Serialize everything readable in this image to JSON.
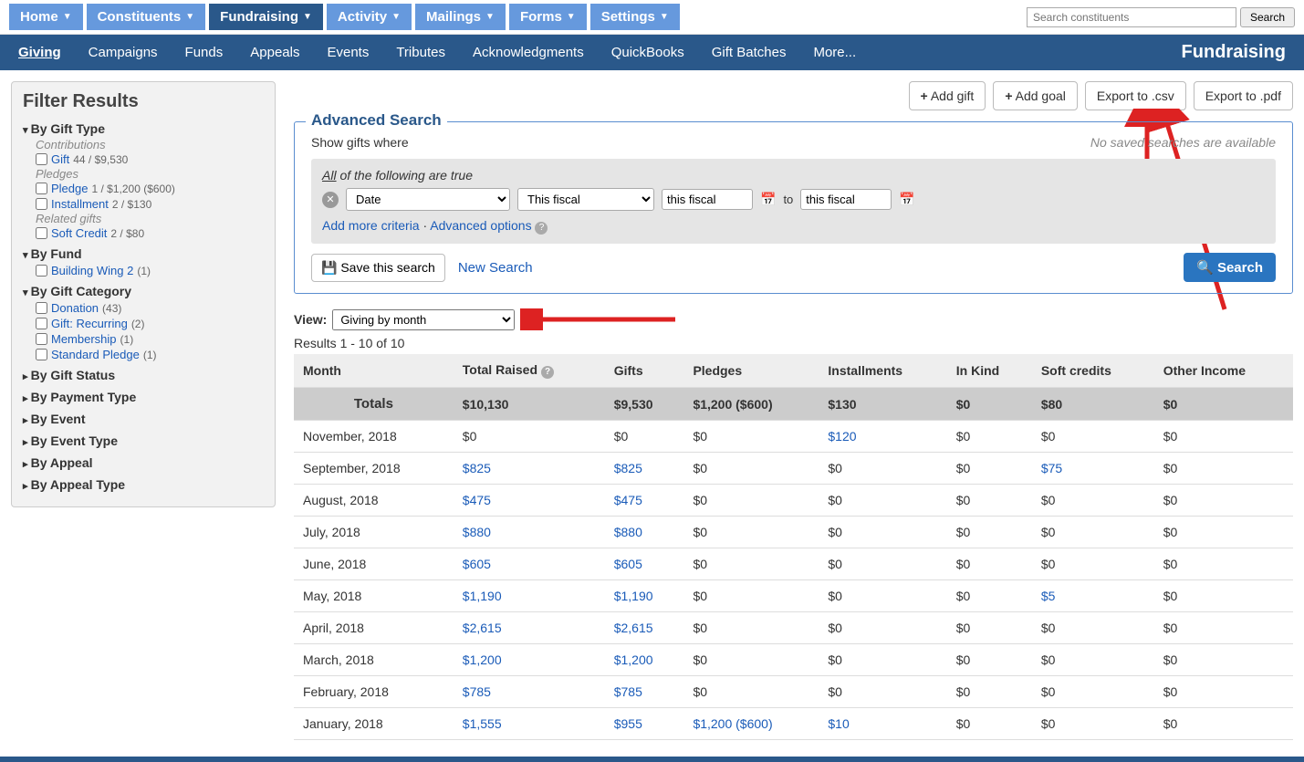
{
  "topnav": [
    {
      "label": "Home"
    },
    {
      "label": "Constituents"
    },
    {
      "label": "Fundraising",
      "active": true
    },
    {
      "label": "Activity"
    },
    {
      "label": "Mailings"
    },
    {
      "label": "Forms"
    },
    {
      "label": "Settings"
    }
  ],
  "search": {
    "placeholder": "Search constituents",
    "button": "Search"
  },
  "subnav": {
    "items": [
      "Giving",
      "Campaigns",
      "Funds",
      "Appeals",
      "Events",
      "Tributes",
      "Acknowledgments",
      "QuickBooks",
      "Gift Batches",
      "More..."
    ],
    "active": "Giving",
    "title": "Fundraising"
  },
  "sidebar": {
    "title": "Filter Results",
    "groups": [
      {
        "title": "By Gift Type",
        "open": true,
        "subs": [
          {
            "header": "Contributions",
            "items": [
              {
                "label": "Gift",
                "count": "44 / $9,530"
              }
            ]
          },
          {
            "header": "Pledges",
            "items": [
              {
                "label": "Pledge",
                "count": "1 / $1,200 ($600)"
              },
              {
                "label": "Installment",
                "count": "2 / $130"
              }
            ]
          },
          {
            "header": "Related gifts",
            "items": [
              {
                "label": "Soft Credit",
                "count": "2 / $80"
              }
            ]
          }
        ]
      },
      {
        "title": "By Fund",
        "open": true,
        "subs": [
          {
            "items": [
              {
                "label": "Building Wing 2",
                "count": "(1)"
              }
            ]
          }
        ]
      },
      {
        "title": "By Gift Category",
        "open": true,
        "subs": [
          {
            "items": [
              {
                "label": "Donation",
                "count": "(43)"
              },
              {
                "label": "Gift: Recurring",
                "count": "(2)"
              },
              {
                "label": "Membership",
                "count": "(1)"
              },
              {
                "label": "Standard Pledge",
                "count": "(1)"
              }
            ]
          }
        ]
      },
      {
        "title": "By Gift Status"
      },
      {
        "title": "By Payment Type"
      },
      {
        "title": "By Event"
      },
      {
        "title": "By Event Type"
      },
      {
        "title": "By Appeal"
      },
      {
        "title": "By Appeal Type"
      }
    ]
  },
  "actions": {
    "add_gift": "Add gift",
    "add_goal": "Add goal",
    "export_csv": "Export to .csv",
    "export_pdf": "Export to .pdf"
  },
  "adv": {
    "legend": "Advanced Search",
    "show": "Show gifts where",
    "saved": "No saved searches are available",
    "all_line_pre": "All",
    "all_line_post": " of the following are true",
    "field": "Date",
    "op": "This fiscal",
    "from": "this fiscal",
    "to_label": "to",
    "to": "this fiscal",
    "add_criteria": "Add more criteria",
    "adv_options": "Advanced options",
    "save": "Save this search",
    "new": "New Search",
    "go": "Search"
  },
  "view": {
    "label": "View:",
    "value": "Giving by month"
  },
  "results_text": "Results 1 - 10 of 10",
  "columns": [
    "Month",
    "Total Raised",
    "Gifts",
    "Pledges",
    "Installments",
    "In Kind",
    "Soft credits",
    "Other Income"
  ],
  "totals": {
    "label": "Totals",
    "values": [
      "$10,130",
      "$9,530",
      "$1,200 ($600)",
      "$130",
      "$0",
      "$80",
      "$0"
    ]
  },
  "rows": [
    {
      "month": "November, 2018",
      "values": [
        "$0",
        "$0",
        "$0",
        "$120",
        "$0",
        "$0",
        "$0"
      ],
      "links": [
        false,
        false,
        false,
        true,
        false,
        false,
        false
      ]
    },
    {
      "month": "September, 2018",
      "values": [
        "$825",
        "$825",
        "$0",
        "$0",
        "$0",
        "$75",
        "$0"
      ],
      "links": [
        true,
        true,
        false,
        false,
        false,
        true,
        false
      ]
    },
    {
      "month": "August, 2018",
      "values": [
        "$475",
        "$475",
        "$0",
        "$0",
        "$0",
        "$0",
        "$0"
      ],
      "links": [
        true,
        true,
        false,
        false,
        false,
        false,
        false
      ]
    },
    {
      "month": "July, 2018",
      "values": [
        "$880",
        "$880",
        "$0",
        "$0",
        "$0",
        "$0",
        "$0"
      ],
      "links": [
        true,
        true,
        false,
        false,
        false,
        false,
        false
      ]
    },
    {
      "month": "June, 2018",
      "values": [
        "$605",
        "$605",
        "$0",
        "$0",
        "$0",
        "$0",
        "$0"
      ],
      "links": [
        true,
        true,
        false,
        false,
        false,
        false,
        false
      ]
    },
    {
      "month": "May, 2018",
      "values": [
        "$1,190",
        "$1,190",
        "$0",
        "$0",
        "$0",
        "$5",
        "$0"
      ],
      "links": [
        true,
        true,
        false,
        false,
        false,
        true,
        false
      ]
    },
    {
      "month": "April, 2018",
      "values": [
        "$2,615",
        "$2,615",
        "$0",
        "$0",
        "$0",
        "$0",
        "$0"
      ],
      "links": [
        true,
        true,
        false,
        false,
        false,
        false,
        false
      ]
    },
    {
      "month": "March, 2018",
      "values": [
        "$1,200",
        "$1,200",
        "$0",
        "$0",
        "$0",
        "$0",
        "$0"
      ],
      "links": [
        true,
        true,
        false,
        false,
        false,
        false,
        false
      ]
    },
    {
      "month": "February, 2018",
      "values": [
        "$785",
        "$785",
        "$0",
        "$0",
        "$0",
        "$0",
        "$0"
      ],
      "links": [
        true,
        true,
        false,
        false,
        false,
        false,
        false
      ]
    },
    {
      "month": "January, 2018",
      "values": [
        "$1,555",
        "$955",
        "$1,200 ($600)",
        "$10",
        "$0",
        "$0",
        "$0"
      ],
      "links": [
        true,
        true,
        true,
        true,
        false,
        false,
        false
      ]
    }
  ]
}
